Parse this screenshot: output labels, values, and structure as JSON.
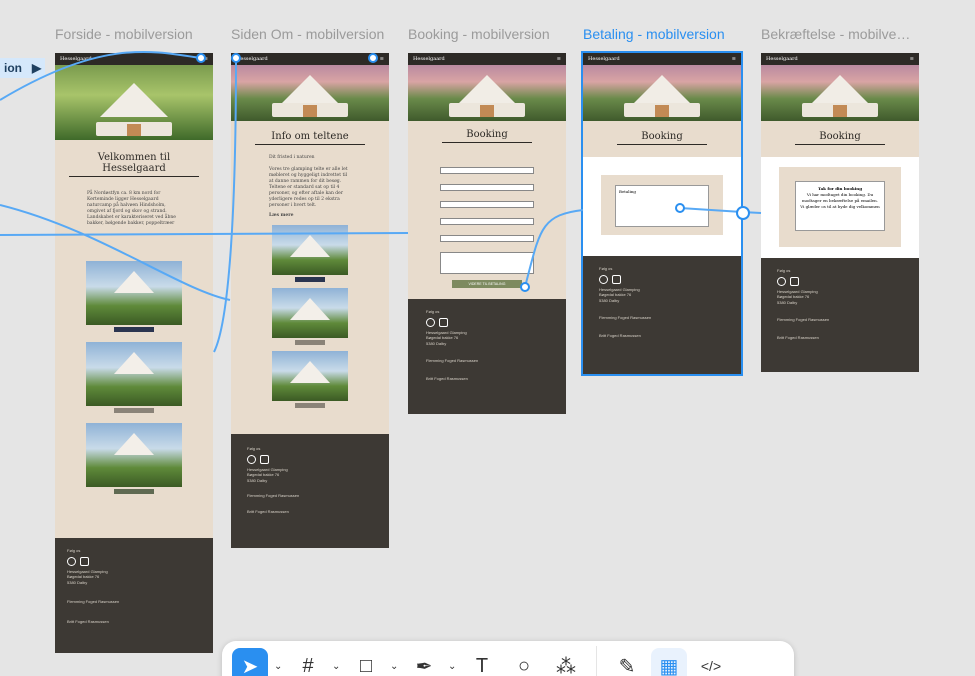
{
  "frames": [
    {
      "title": "Forside - mobilversion",
      "heading": "Velkommen til Hesselgaard",
      "body": "På Nordøstfyn ca. 8 km nord for Kerteminde ligger Hesselgaard naturcamp på halvøen Hindsholm, omgivet af fjord og skov og strand. Landskabet er karakteriseret ved åbne bakker, bølgende bakker, poppeltræer",
      "button1": "SE MERE OM",
      "button2": "SE MERE OM",
      "button3": "SE MERE OM"
    },
    {
      "title": "Siden Om - mobilversion",
      "heading": "Info om teltene",
      "sub": "Dit fristed i naturen",
      "body": "Vores tre glamping telte er alle let møbleret og hyggeligt indrettet til at danne rammen for dit besøg. Teltene er standard sat op til 4 personer, og efter aftale kan der yderligere redes op til 2 ekstra personer i hvert telt.",
      "more": "Læs mere"
    },
    {
      "title": "Booking - mobilversion",
      "heading": "Booking",
      "submit": "VIDERE TIL BETALING"
    },
    {
      "title": "Betaling - mobilversion",
      "heading": "Booking",
      "payment_title": "Betaling"
    },
    {
      "title": "Bekræftelse - mobilversion",
      "heading": "Booking",
      "thanks_title": "Tak for din booking",
      "thanks_body": "Vi har modtaget din booking. Du modtager en bekræftelse på emailen. Vi glæder os til at byde dig velkommen"
    }
  ],
  "footer": {
    "follow": "Følg os",
    "company": "Hesselgaard Glamping",
    "addr1": "Bøgedal bakke 76",
    "addr2": "5380 Dalby",
    "person1": "Flemming Foged Rasmussen",
    "person2": "Britt Foged Rasmussen"
  },
  "left_tag": "ion",
  "toolbar": {
    "items": [
      "move-tool",
      "frame-tool",
      "shape-tool",
      "pen-tool",
      "text-tool",
      "comment-tool",
      "actions-tool",
      "draw-mode",
      "design-mode",
      "dev-mode"
    ]
  },
  "colors": {
    "accent": "#2a8ff0",
    "beige": "#e8dccd",
    "dark": "#3d3934"
  }
}
